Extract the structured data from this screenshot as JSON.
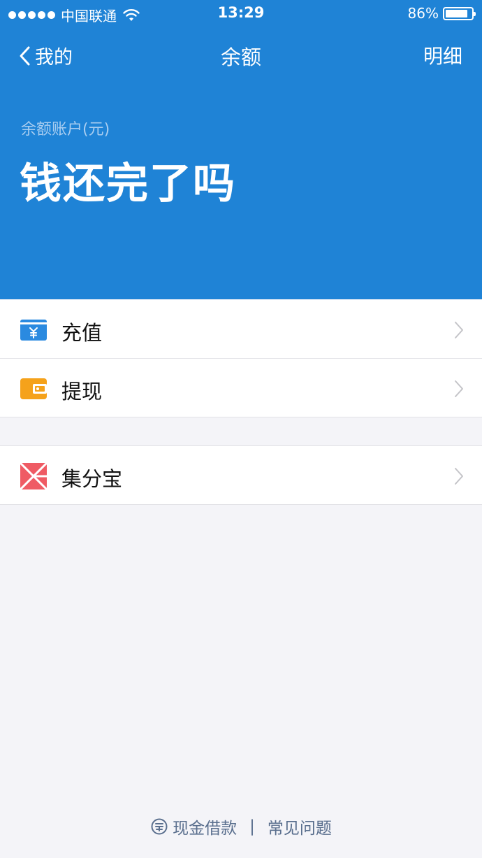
{
  "status_bar": {
    "carrier": "中国联通",
    "time": "13:29",
    "battery_percent": "86%",
    "battery_level": 0.86
  },
  "nav": {
    "back_label": "我的",
    "title": "余额",
    "detail_label": "明细"
  },
  "balance": {
    "label": "余额账户(元)",
    "value": "钱还完了吗"
  },
  "menu": {
    "items": [
      {
        "label": "充值",
        "icon": "recharge-icon",
        "color": "#2a8ae0"
      },
      {
        "label": "提现",
        "icon": "wallet-icon",
        "color": "#f5a21b"
      },
      {
        "label": "集分宝",
        "icon": "jifenbao-icon",
        "color": "#ef5b64"
      }
    ]
  },
  "footer": {
    "cash_loan": "现金借款",
    "separator": "|",
    "faq": "常见问题"
  },
  "colors": {
    "header_bg": "#1f83d6",
    "page_bg": "#f4f4f8",
    "footer_text": "#5a6f8e"
  }
}
